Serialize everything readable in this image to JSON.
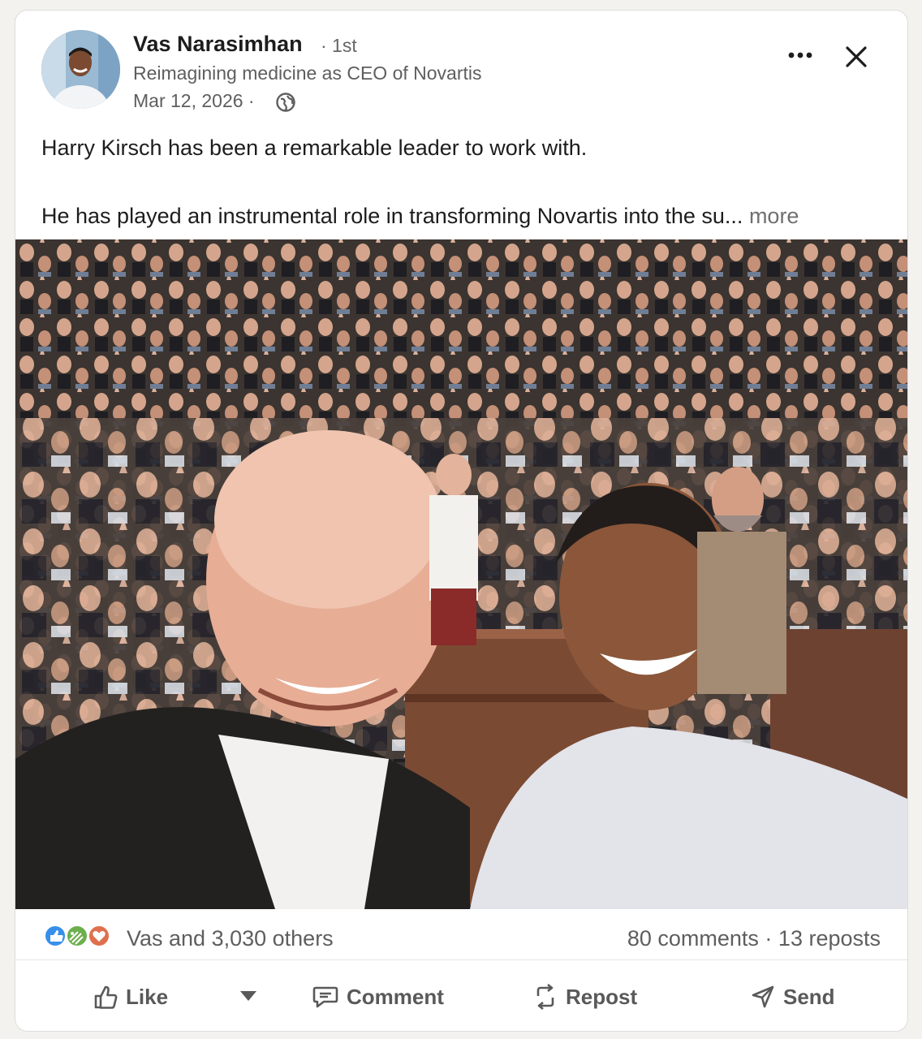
{
  "post": {
    "author": {
      "name": "Vas Narasimhan",
      "degree": "· 1st",
      "headline": "Reimagining medicine as CEO of Novartis",
      "date": "Mar 12, 2026 ·"
    },
    "text": {
      "line1": "Harry Kirsch has been a remarkable leader to work with.",
      "line2": "He has played an instrumental role in transforming Novartis into the su...",
      "more": "more"
    },
    "image": {
      "icon": "photo-image"
    }
  },
  "social": {
    "reaction_icons": [
      "like-reaction-icon",
      "celebrate-reaction-icon",
      "love-reaction-icon"
    ],
    "reaction_count": "Vas and 3,030 others",
    "comments": "80 comments",
    "separator": "·",
    "reposts": "13 reposts"
  },
  "actions": {
    "like": "Like",
    "comment": "Comment",
    "repost": "Repost",
    "send": "Send"
  },
  "colors": {
    "text_primary": "#1d1d1d",
    "text_secondary": "#5e5e5e",
    "like_blue": "#378fe9",
    "celebrate_green": "#44712e",
    "love_red": "#df704d"
  }
}
